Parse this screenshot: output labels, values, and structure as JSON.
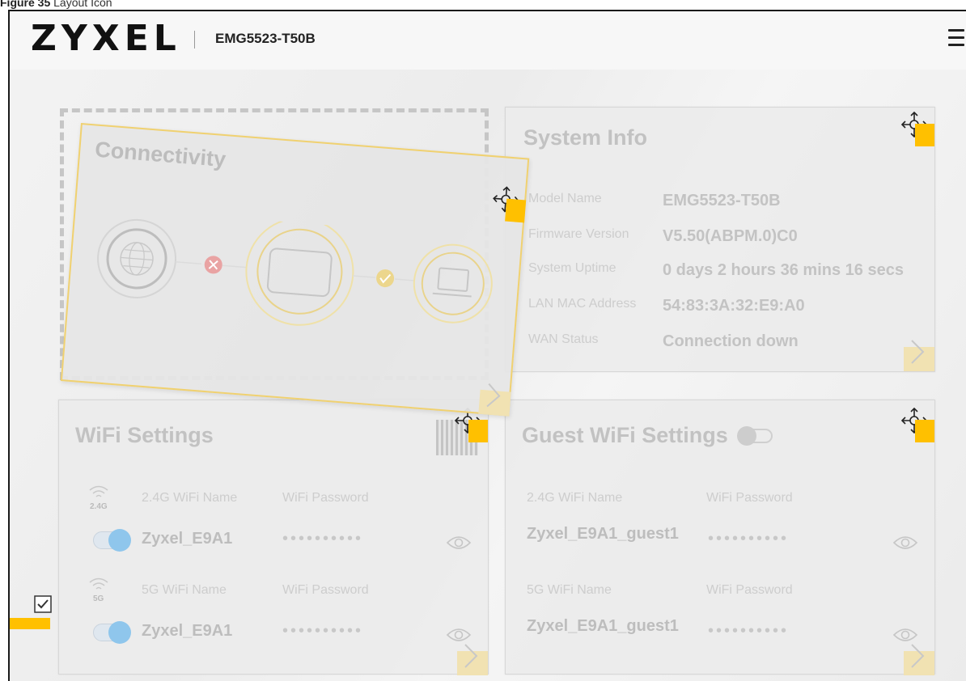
{
  "caption": {
    "figure": "Figure 35",
    "text": "Layout Icon"
  },
  "header": {
    "brand": "ZYXEL",
    "model": "EMG5523-T50B"
  },
  "connectivity": {
    "title": "Connectivity"
  },
  "system_info": {
    "title": "System Info",
    "rows": [
      {
        "label": "Model Name",
        "value": "EMG5523-T50B"
      },
      {
        "label": "Firmware Version",
        "value": "V5.50(ABPM.0)C0"
      },
      {
        "label": "System Uptime",
        "value": "0 days 2 hours 36 mins 16 secs"
      },
      {
        "label": "LAN MAC Address",
        "value": "54:83:3A:32:E9:A0"
      },
      {
        "label": "WAN Status",
        "value": "Connection down"
      }
    ]
  },
  "wifi": {
    "title": "WiFi Settings",
    "band_24": {
      "tag": "2.4G",
      "name_label": "2.4G WiFi Name",
      "pass_label": "WiFi Password",
      "name": "Zyxel_E9A1",
      "password": "••••••••••"
    },
    "band_5": {
      "tag": "5G",
      "name_label": "5G WiFi Name",
      "pass_label": "WiFi Password",
      "name": "Zyxel_E9A1",
      "password": "••••••••••"
    }
  },
  "guest_wifi": {
    "title": "Guest WiFi Settings",
    "band_24": {
      "name_label": "2.4G WiFi Name",
      "pass_label": "WiFi Password",
      "name": "Zyxel_E9A1_guest1",
      "password": "••••••••••"
    },
    "band_5": {
      "name_label": "5G WiFi Name",
      "pass_label": "WiFi Password",
      "name": "Zyxel_E9A1_guest1",
      "password": "••••••••••"
    }
  },
  "colors": {
    "accent": "#ffc000",
    "toggle_on": "#8fc6ec",
    "error": "#e06a6a",
    "ok": "#e8c74a"
  }
}
